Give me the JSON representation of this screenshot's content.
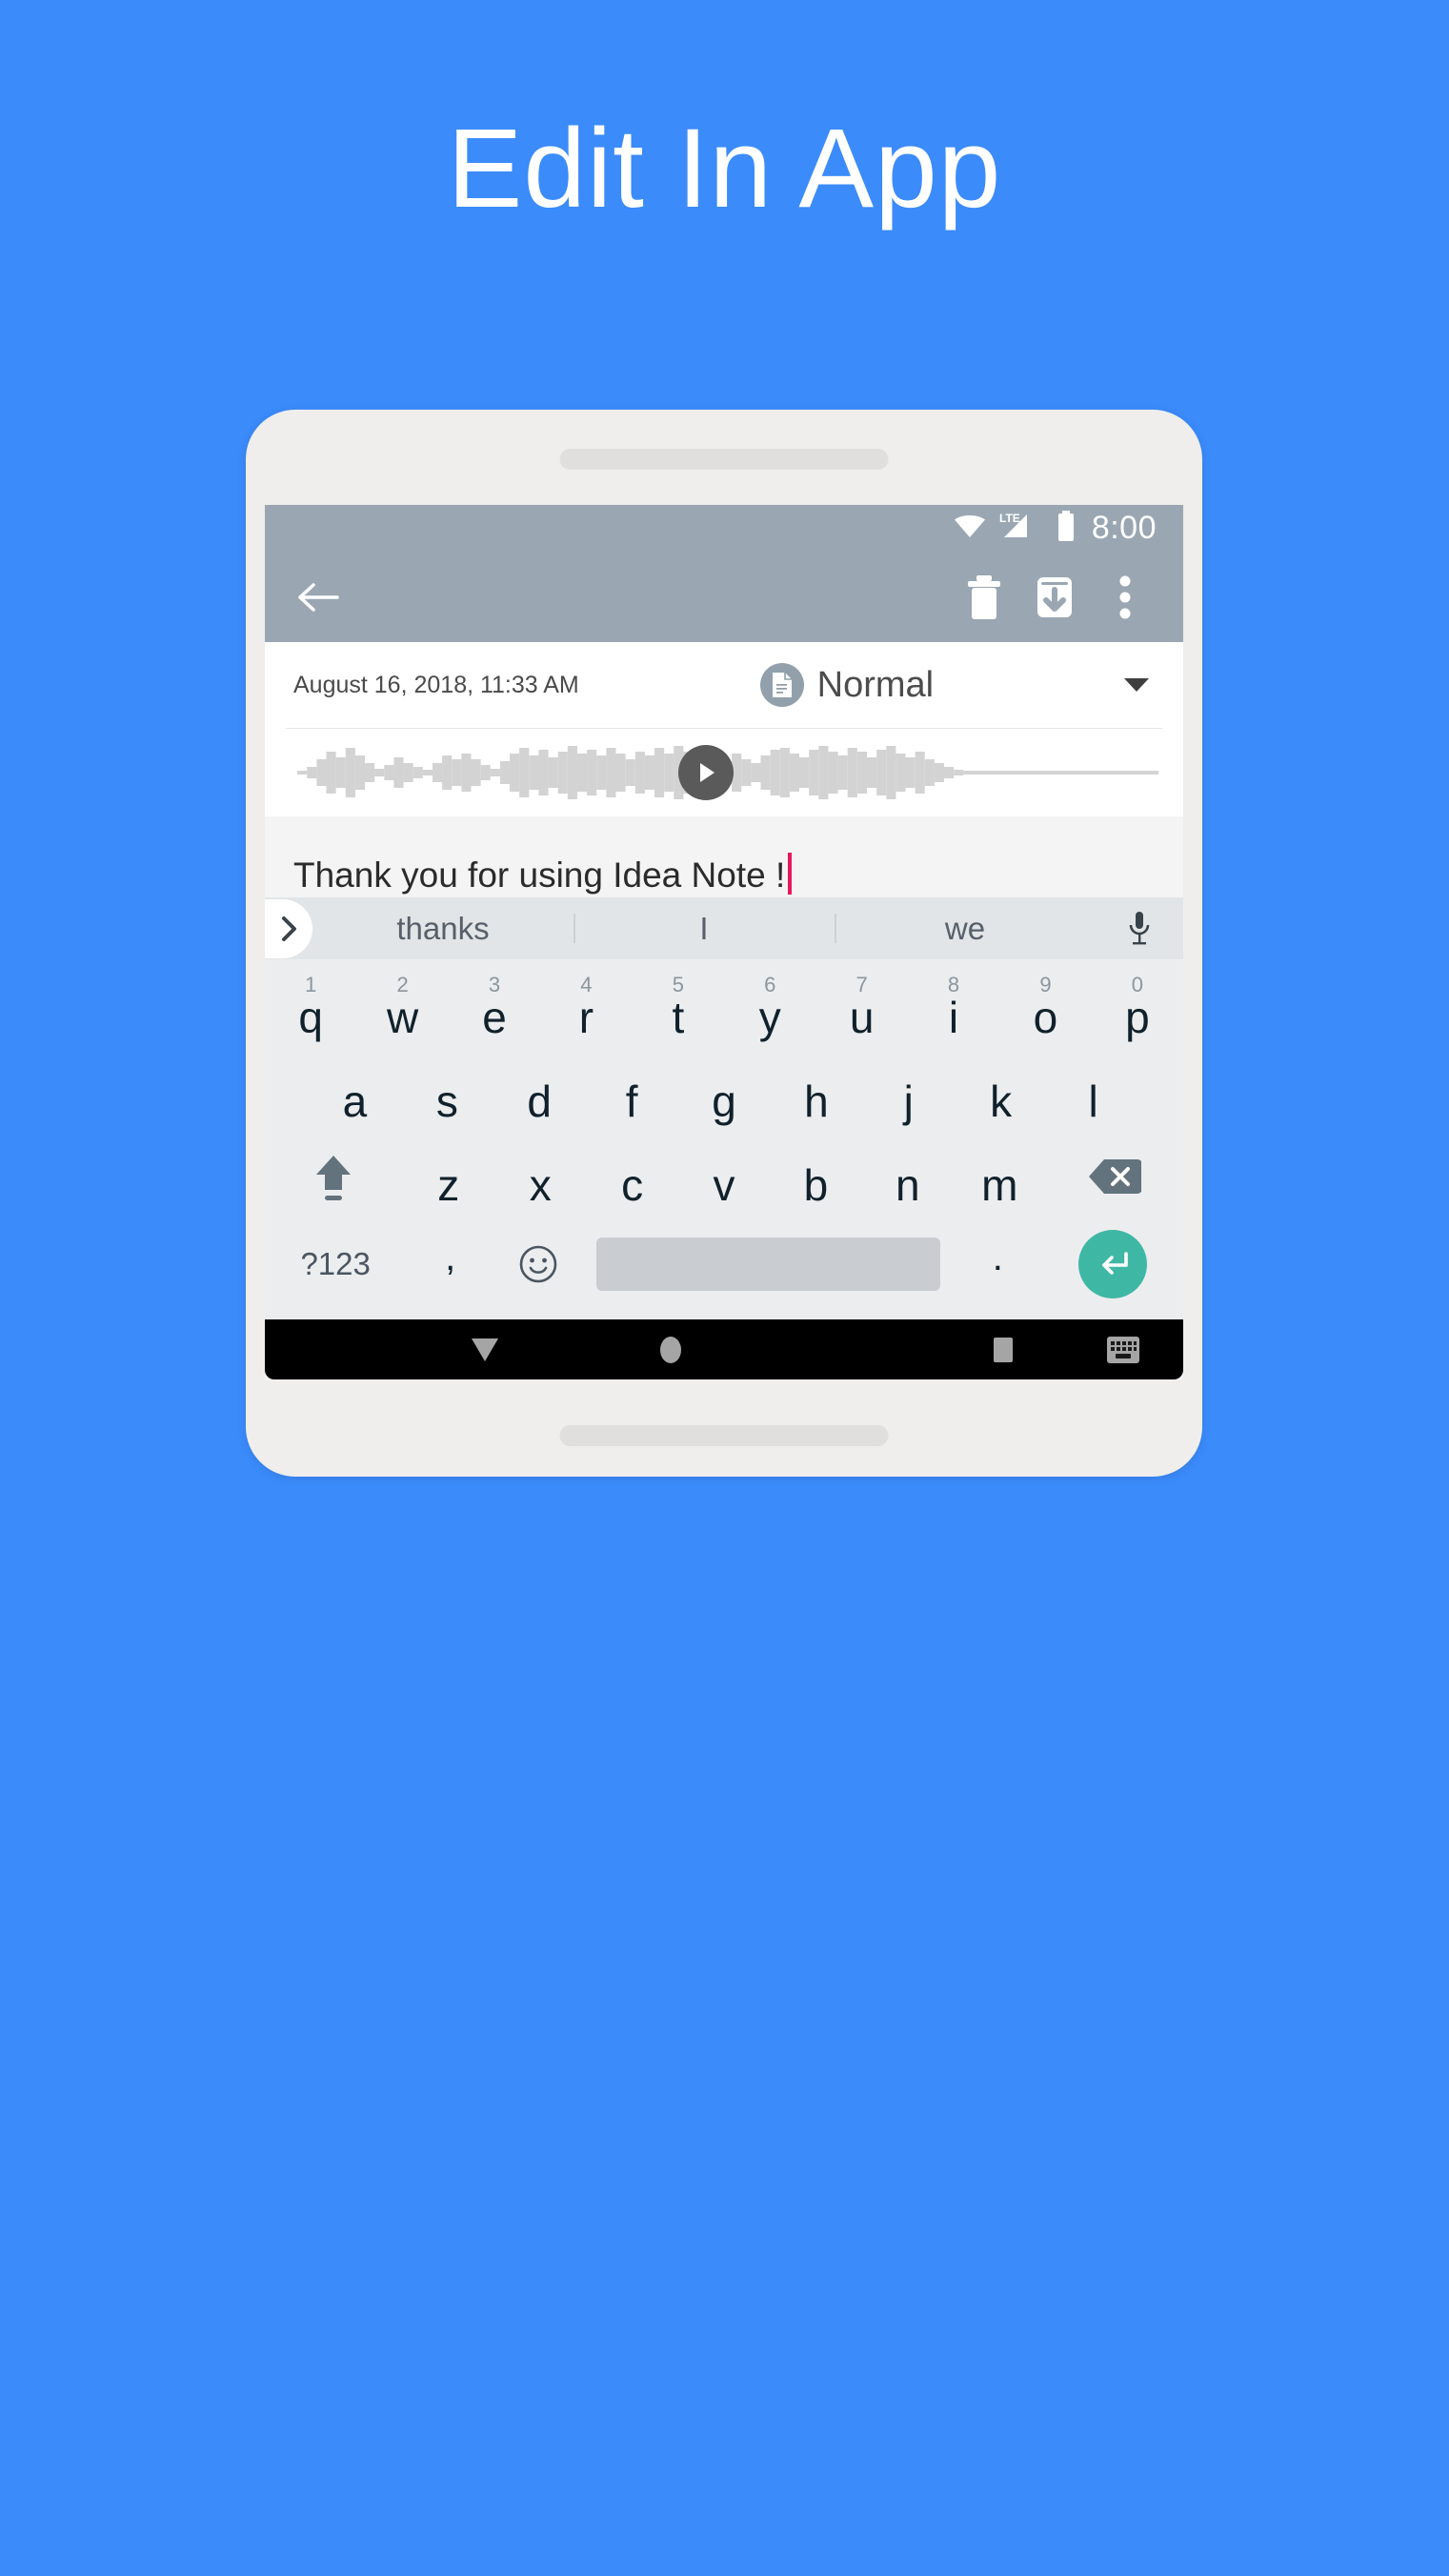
{
  "hero": {
    "title": "Edit In App"
  },
  "colors": {
    "background": "#3b8bfb",
    "phone_frame": "#efeeec",
    "toolbar": "#9aa7b2",
    "accent_enter": "#3fb7a5",
    "caret": "#e8175d",
    "nav_bar": "#000000"
  },
  "status_bar": {
    "wifi_icon": "wifi-icon",
    "network_label": "LTE",
    "signal_icon": "signal-icon",
    "battery_icon": "battery-icon",
    "clock": "8:00"
  },
  "toolbar": {
    "back_icon": "arrow-left-icon",
    "delete_icon": "trash-icon",
    "archive_icon": "archive-download-icon",
    "overflow_icon": "more-vertical-icon"
  },
  "note": {
    "date": "August 16, 2018, 11:33 AM",
    "type_icon": "document-icon",
    "type_label": "Normal",
    "type_caret_icon": "chevron-down-icon",
    "body_text": "Thank you for using Idea Note !",
    "audio": {
      "play_icon": "play-icon",
      "waveform_icon": "audio-waveform"
    }
  },
  "suggestions": {
    "expand_icon": "chevron-right-icon",
    "items": [
      "thanks",
      "I",
      "we"
    ],
    "mic_icon": "microphone-icon"
  },
  "keyboard": {
    "row1": [
      {
        "letter": "q",
        "num": "1"
      },
      {
        "letter": "w",
        "num": "2"
      },
      {
        "letter": "e",
        "num": "3"
      },
      {
        "letter": "r",
        "num": "4"
      },
      {
        "letter": "t",
        "num": "5"
      },
      {
        "letter": "y",
        "num": "6"
      },
      {
        "letter": "u",
        "num": "7"
      },
      {
        "letter": "i",
        "num": "8"
      },
      {
        "letter": "o",
        "num": "9"
      },
      {
        "letter": "p",
        "num": "0"
      }
    ],
    "row2": [
      "a",
      "s",
      "d",
      "f",
      "g",
      "h",
      "j",
      "k",
      "l"
    ],
    "row3": [
      "z",
      "x",
      "c",
      "v",
      "b",
      "n",
      "m"
    ],
    "shift_icon": "shift-arrow-up-icon",
    "backspace_icon": "backspace-icon",
    "row4": {
      "symbols_label": "?123",
      "comma_label": ",",
      "emoji_icon": "emoji-smiley-icon",
      "space_label": "",
      "period_label": ".",
      "enter_icon": "enter-return-icon"
    }
  },
  "nav_bar": {
    "back_icon": "triangle-down-icon",
    "home_icon": "circle-home-icon",
    "recents_icon": "square-recents-icon",
    "keyboard_icon": "keyboard-icon"
  }
}
